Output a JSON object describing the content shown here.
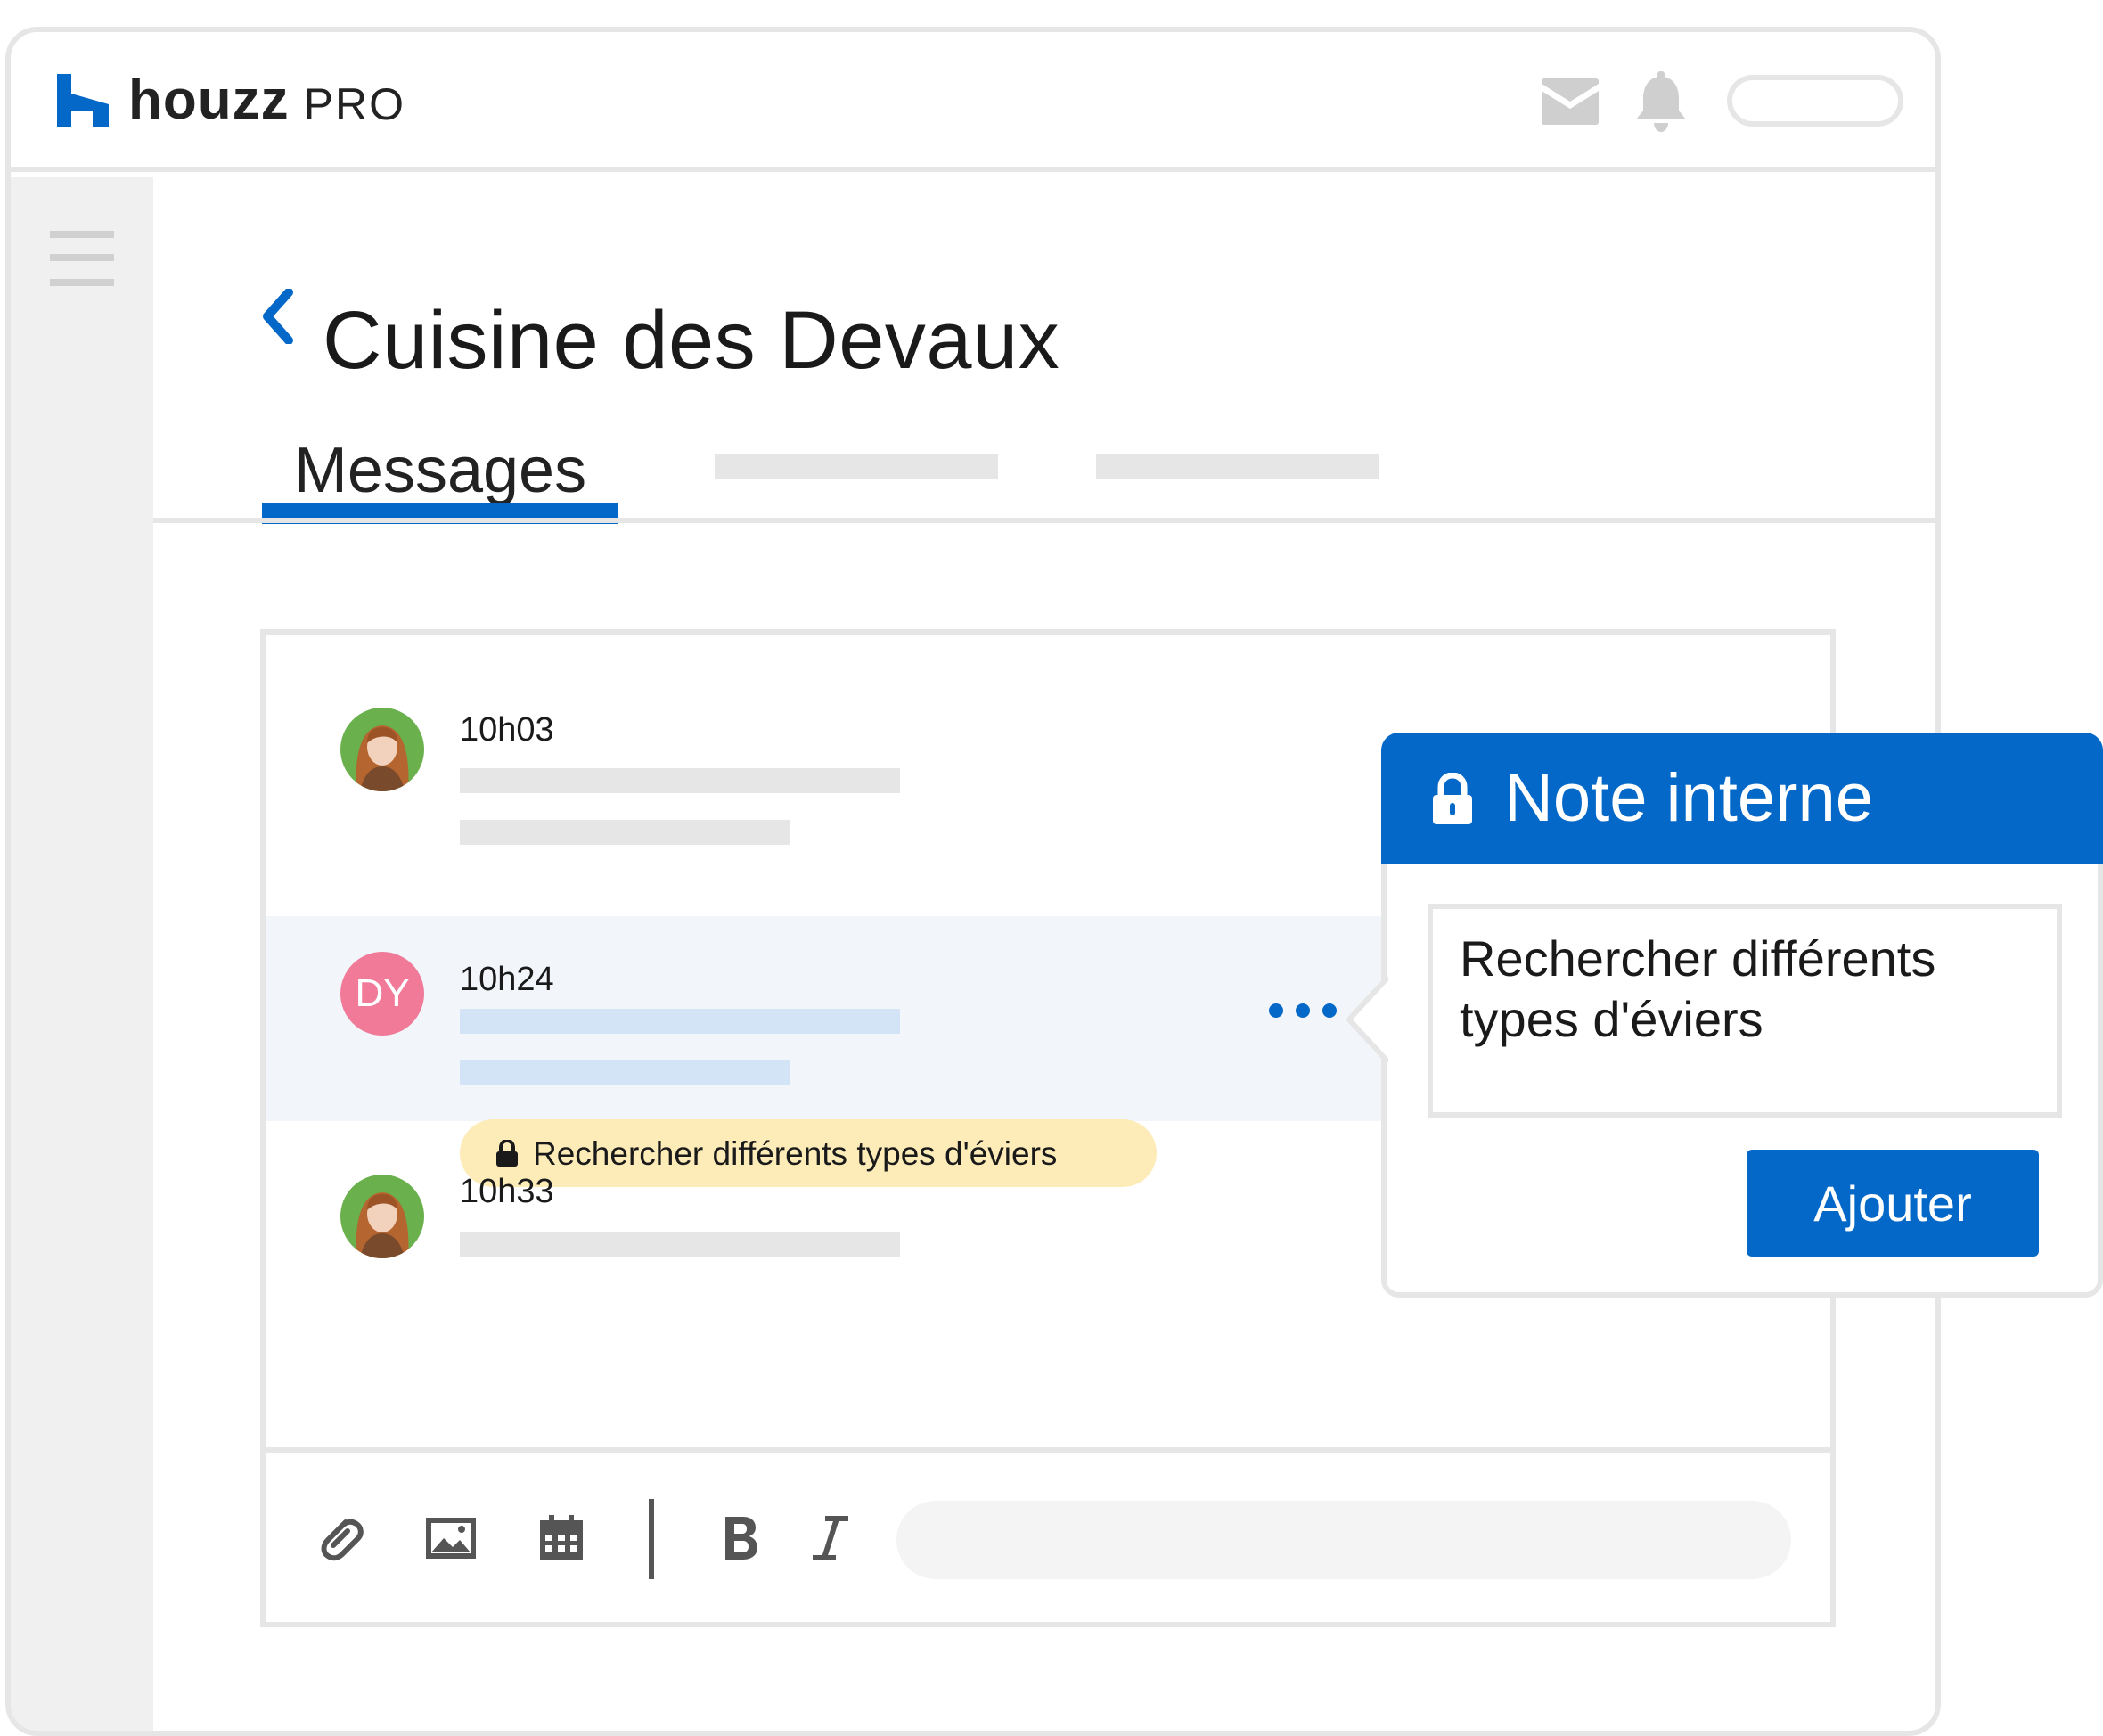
{
  "header": {
    "brand": "houzz",
    "brand_suffix": "PRO"
  },
  "project": {
    "title": "Cuisine des Devaux"
  },
  "tabs": [
    {
      "label": "Messages",
      "active": true
    }
  ],
  "messages": [
    {
      "time": "10h03",
      "avatar": "photo"
    },
    {
      "time": "10h24",
      "avatar_initials": "DY",
      "internal_note": "Rechercher différents types d'éviers"
    },
    {
      "time": "10h33",
      "avatar": "photo"
    }
  ],
  "note_popup": {
    "title": "Note interne",
    "note_text": "Rechercher différents types d'éviers",
    "add_label": "Ajouter"
  },
  "colors": {
    "brand_blue": "#0468c8",
    "note_chip": "#fdebb8",
    "avatar_dy": "#f07a98",
    "highlight_row": "#f2f6fb"
  },
  "icons": {
    "toolbar": [
      "paperclip-icon",
      "image-icon",
      "calendar-icon",
      "bold-icon",
      "italic-icon"
    ]
  }
}
